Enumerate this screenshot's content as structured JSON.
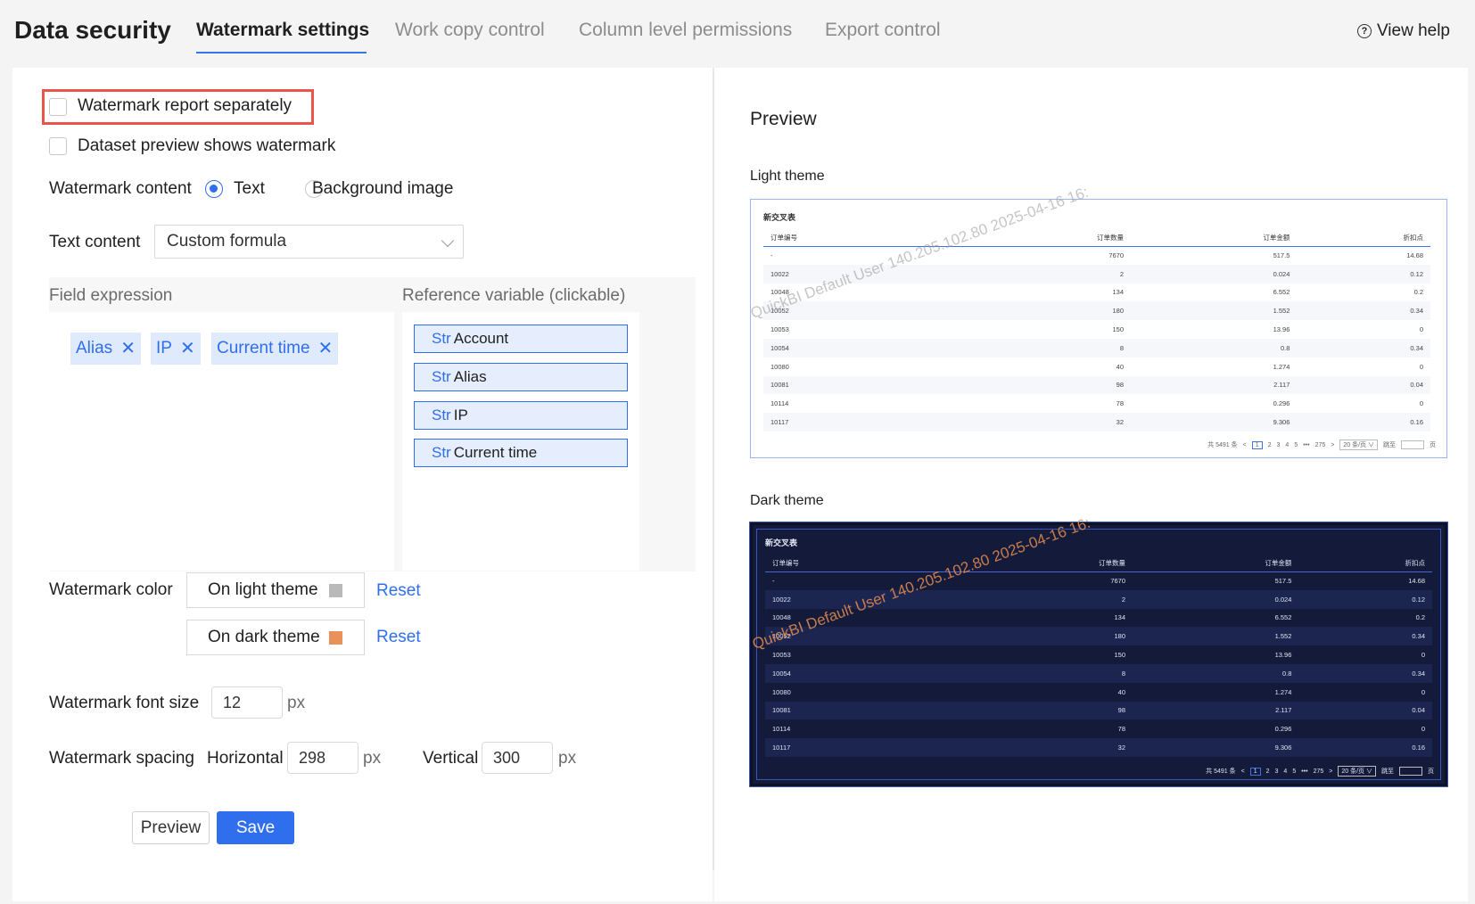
{
  "header": {
    "title": "Data security",
    "tabs": [
      {
        "label": "Watermark settings",
        "active": true
      },
      {
        "label": "Work copy control",
        "active": false
      },
      {
        "label": "Column level permissions",
        "active": false
      },
      {
        "label": "Export control",
        "active": false
      }
    ],
    "help_label": "View help"
  },
  "settings": {
    "watermark_report_separately": {
      "label": "Watermark report separately",
      "checked": false
    },
    "dataset_preview_watermark": {
      "label": "Dataset preview shows watermark",
      "checked": false
    },
    "content": {
      "label": "Watermark content",
      "options": [
        {
          "label": "Text",
          "selected": true
        },
        {
          "label": "Background image",
          "selected": false
        }
      ]
    },
    "text_content": {
      "label": "Text content",
      "value": "Custom formula"
    },
    "field_expression": {
      "label": "Field expression",
      "tags": [
        "Alias",
        "IP",
        "Current time"
      ]
    },
    "reference_variables": {
      "label": "Reference variable (clickable)",
      "type_label": "Str",
      "items": [
        "Account",
        "Alias",
        "IP",
        "Current time"
      ]
    },
    "color": {
      "label": "Watermark color",
      "light": {
        "label": "On light theme",
        "swatch": "#b9b9b9"
      },
      "dark": {
        "label": "On dark theme",
        "swatch": "#e8915a"
      },
      "reset_label": "Reset"
    },
    "font_size": {
      "label": "Watermark font size",
      "value": "12",
      "unit": "px"
    },
    "spacing": {
      "label": "Watermark spacing",
      "horizontal_label": "Horizontal",
      "horizontal_value": "298",
      "vertical_label": "Vertical",
      "vertical_value": "300",
      "unit": "px"
    },
    "buttons": {
      "preview": "Preview",
      "save": "Save"
    }
  },
  "preview": {
    "title": "Preview",
    "light_label": "Light theme",
    "dark_label": "Dark theme",
    "sheet_title": "新交叉表",
    "watermark_text": "QuickBI Default User 140.205.102.80 2025-04-16 16:",
    "columns": [
      "订单编号",
      "订单数量",
      "订单金额",
      "折扣点"
    ],
    "rows": [
      [
        "-",
        "7670",
        "517.5",
        "14.68"
      ],
      [
        "10022",
        "2",
        "0.024",
        "0.12"
      ],
      [
        "10048",
        "134",
        "6.552",
        "0.2"
      ],
      [
        "10052",
        "180",
        "1.552",
        "0.34"
      ],
      [
        "10053",
        "150",
        "13.96",
        "0"
      ],
      [
        "10054",
        "8",
        "0.8",
        "0.34"
      ],
      [
        "10080",
        "40",
        "1.274",
        "0"
      ],
      [
        "10081",
        "98",
        "2.117",
        "0.04"
      ],
      [
        "10114",
        "78",
        "0.296",
        "0"
      ],
      [
        "10117",
        "32",
        "9.306",
        "0.16"
      ]
    ],
    "pager": {
      "total": "共 5491 条",
      "prev": "<",
      "pages": [
        "1",
        "2",
        "3",
        "4",
        "5"
      ],
      "ellipsis": "•••",
      "last": "275",
      "next": ">",
      "page_size": "20 条/页",
      "jump_label": "跳至",
      "jump_suffix": "页"
    }
  }
}
